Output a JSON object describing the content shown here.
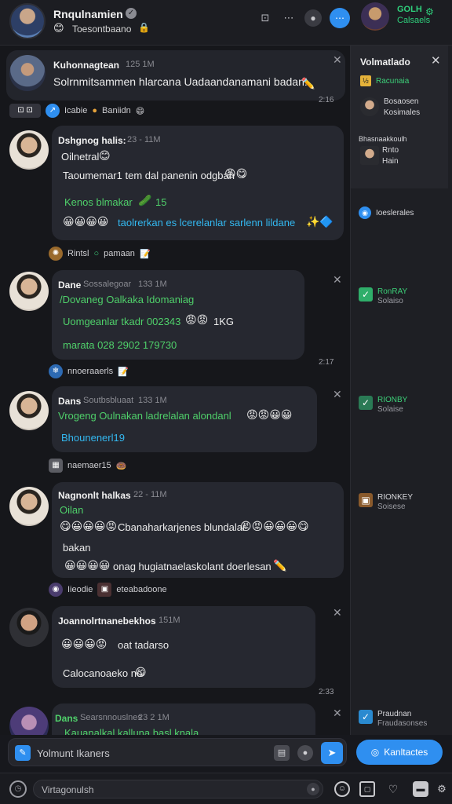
{
  "header": {
    "name": "Rnqulnamien",
    "status": "Toesontbaano",
    "icons": [
      "pin-icon",
      "more-icon",
      "record-icon",
      "call-icon"
    ]
  },
  "header_right": {
    "title": "GOLH",
    "subtitle": "Calsaels"
  },
  "chat": {
    "messages": [
      {
        "name": "Kuhonnagtean",
        "time": "125 1M",
        "lines": [
          "Solrnmitsammen hlarcana Uadaandanamani badan!"
        ],
        "ts": "2:16",
        "reactions": [
          "Icabie",
          "Baniidn"
        ]
      },
      {
        "name": "Dshgnog halis:",
        "time": "23 - 11M",
        "lines": [
          "Oilnetral",
          "Taoumemar1 tem dal panenin odgbah",
          "Kenos blmakar",
          "taolrerkan es lcerelanlar sarlenn lildane"
        ],
        "tags": [
          "15"
        ],
        "reactions": [
          "Rintsl",
          "pamaan"
        ]
      },
      {
        "name": "Dane",
        "subname": "Sossalegoar",
        "time": "133 1M",
        "lines": [
          "/Dovaneg Oalkaka Idomaniag",
          "Uomgeanlar tkadr 002343",
          "marata 028 2902 179730"
        ],
        "extra": "1KG",
        "ts": "2:17",
        "reactions": [
          "nnoeraaerls"
        ]
      },
      {
        "name": "Dans",
        "subname": "Soutbsbluaat",
        "time": "133 1M",
        "lines": [
          "Vrogeng Oulnakan ladrelalan alondanl",
          "Bhounenerl19"
        ],
        "reactions": [
          "naemaer15"
        ]
      },
      {
        "name": "Nagnonlt halkas",
        "time": "22 - 11M",
        "lines": [
          "Oilan",
          "Cbanaharkarjenes blundalar",
          "bakan",
          "onag hugiatnaelaskolant doerlesan"
        ],
        "reactions": [
          "Iieodie",
          "eteabadoone"
        ]
      },
      {
        "name": "Joannolrtnanebekhos",
        "time": "151M",
        "lines": [
          "oat tadarso",
          "Calocanoaeko no"
        ],
        "ts": "2:33"
      },
      {
        "name": "Dans",
        "subname": "Searsnnouslnes",
        "time": "23 2 1M",
        "lines": [
          "Kauanalkal kalluna basl knala"
        ]
      }
    ]
  },
  "panel": {
    "title": "Volmatlado",
    "items": [
      {
        "label": "Racunaia"
      },
      {
        "label": "Bosaosen",
        "sub": "Kosimales"
      },
      {
        "label": "Bhasnaakkoulh"
      },
      {
        "label": "Rnto",
        "sub": "Hain"
      },
      {
        "label": "Ioeslerales"
      },
      {
        "label": "RonRAY",
        "sub": "Solaiso"
      },
      {
        "label": "RIONBY",
        "sub": "Solaise"
      },
      {
        "label": "RIONKEY",
        "sub": "Soisese"
      },
      {
        "label": "Praudnan",
        "sub": "Fraudasonses"
      }
    ],
    "contacts_button": "Kanltactes"
  },
  "composer": {
    "placeholder": "Yolmunt Ikaners"
  },
  "bottom": {
    "placeholder": "Virtagonulsh"
  },
  "colors": {
    "accent": "#2f8ff0",
    "green": "#4fd06a",
    "link_blue": "#33b8f0",
    "bubble": "#262830",
    "background": "#16171b"
  }
}
